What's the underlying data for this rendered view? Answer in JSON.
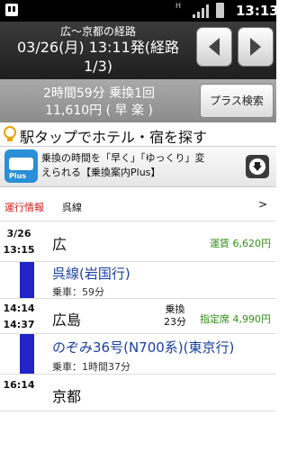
{
  "status_bar": {
    "time": "13:13",
    "network": "H"
  },
  "header": {
    "title": "広～京都の経路",
    "datetime": "03/26(月) 13:11発(経路",
    "route_index": "1/3)"
  },
  "summary": {
    "duration_transfers": "2時間59分 乗換1回",
    "fare_tags": "11,610円 ( 早 楽 )",
    "plus_search_label": "プラス検索"
  },
  "hotel_link": "駅タップでホテル・宿を探す",
  "ad": {
    "text_line1": "乗換の時間を「早く」「ゆっくり」変",
    "text_line2": "えられる【乗換案内Plus】",
    "icon_label": "Plus"
  },
  "operation_info": {
    "label": "運行情報",
    "line": "呉線",
    "chevron": ">"
  },
  "route": {
    "dep_date": "3/26",
    "dep_time": "13:15",
    "origin": "広",
    "fare": "運賃 6,620円",
    "leg1_name": "呉線(岩国行)",
    "leg1_ride": "乗車：59分",
    "transfer_arr": "14:14",
    "transfer_dep": "14:37",
    "transfer_station": "広島",
    "transfer_label": "乗換",
    "transfer_wait": "23分",
    "seat_fare": "指定席 4,990円",
    "leg2_name": "のぞみ36号(N700系)(東京行)",
    "leg2_ride": "乗車：1時間37分",
    "arr_time": "16:14",
    "destination": "京都"
  },
  "colors": {
    "line_bar": "#2323c8",
    "fare_green": "#2f8f14",
    "info_red": "#d0201a"
  }
}
